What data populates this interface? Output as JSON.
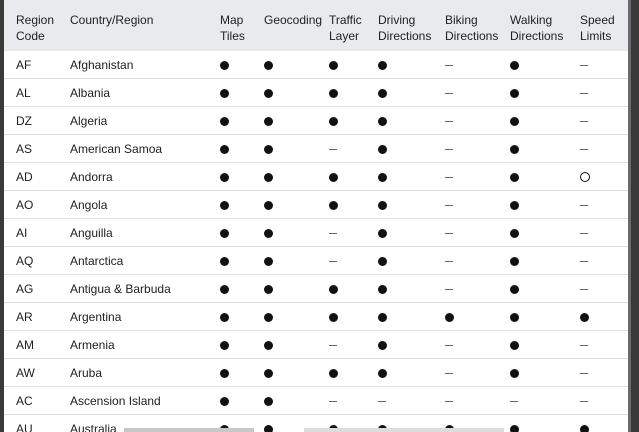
{
  "table": {
    "headers": [
      "Region Code",
      "Country/Region",
      "Map Tiles",
      "Geocoding",
      "Traffic Layer",
      "Driving Directions",
      "Biking Directions",
      "Walking Directions",
      "Speed Limits"
    ],
    "icons": {
      "full": "filled-circle-icon",
      "partial": "hollow-circle-icon",
      "none": "dash-icon"
    },
    "rows": [
      {
        "code": "AF",
        "name": "Afghanistan",
        "values": [
          "full",
          "full",
          "full",
          "full",
          "none",
          "full",
          "none"
        ]
      },
      {
        "code": "AL",
        "name": "Albania",
        "values": [
          "full",
          "full",
          "full",
          "full",
          "none",
          "full",
          "none"
        ]
      },
      {
        "code": "DZ",
        "name": "Algeria",
        "values": [
          "full",
          "full",
          "full",
          "full",
          "none",
          "full",
          "none"
        ]
      },
      {
        "code": "AS",
        "name": "American Samoa",
        "values": [
          "full",
          "full",
          "none",
          "full",
          "none",
          "full",
          "none"
        ]
      },
      {
        "code": "AD",
        "name": "Andorra",
        "values": [
          "full",
          "full",
          "full",
          "full",
          "none",
          "full",
          "partial"
        ]
      },
      {
        "code": "AO",
        "name": "Angola",
        "values": [
          "full",
          "full",
          "full",
          "full",
          "none",
          "full",
          "none"
        ]
      },
      {
        "code": "AI",
        "name": "Anguilla",
        "values": [
          "full",
          "full",
          "none",
          "full",
          "none",
          "full",
          "none"
        ]
      },
      {
        "code": "AQ",
        "name": "Antarctica",
        "values": [
          "full",
          "full",
          "none",
          "full",
          "none",
          "full",
          "none"
        ]
      },
      {
        "code": "AG",
        "name": "Antigua & Barbuda",
        "values": [
          "full",
          "full",
          "full",
          "full",
          "none",
          "full",
          "none"
        ]
      },
      {
        "code": "AR",
        "name": "Argentina",
        "values": [
          "full",
          "full",
          "full",
          "full",
          "full",
          "full",
          "full"
        ]
      },
      {
        "code": "AM",
        "name": "Armenia",
        "values": [
          "full",
          "full",
          "none",
          "full",
          "none",
          "full",
          "none"
        ]
      },
      {
        "code": "AW",
        "name": "Aruba",
        "values": [
          "full",
          "full",
          "full",
          "full",
          "none",
          "full",
          "none"
        ]
      },
      {
        "code": "AC",
        "name": "Ascension Island",
        "values": [
          "full",
          "full",
          "none",
          "none",
          "none",
          "none",
          "none"
        ]
      },
      {
        "code": "AU",
        "name": "Australia",
        "values": [
          "full",
          "full",
          "full",
          "full",
          "full",
          "full",
          "full"
        ]
      }
    ]
  }
}
